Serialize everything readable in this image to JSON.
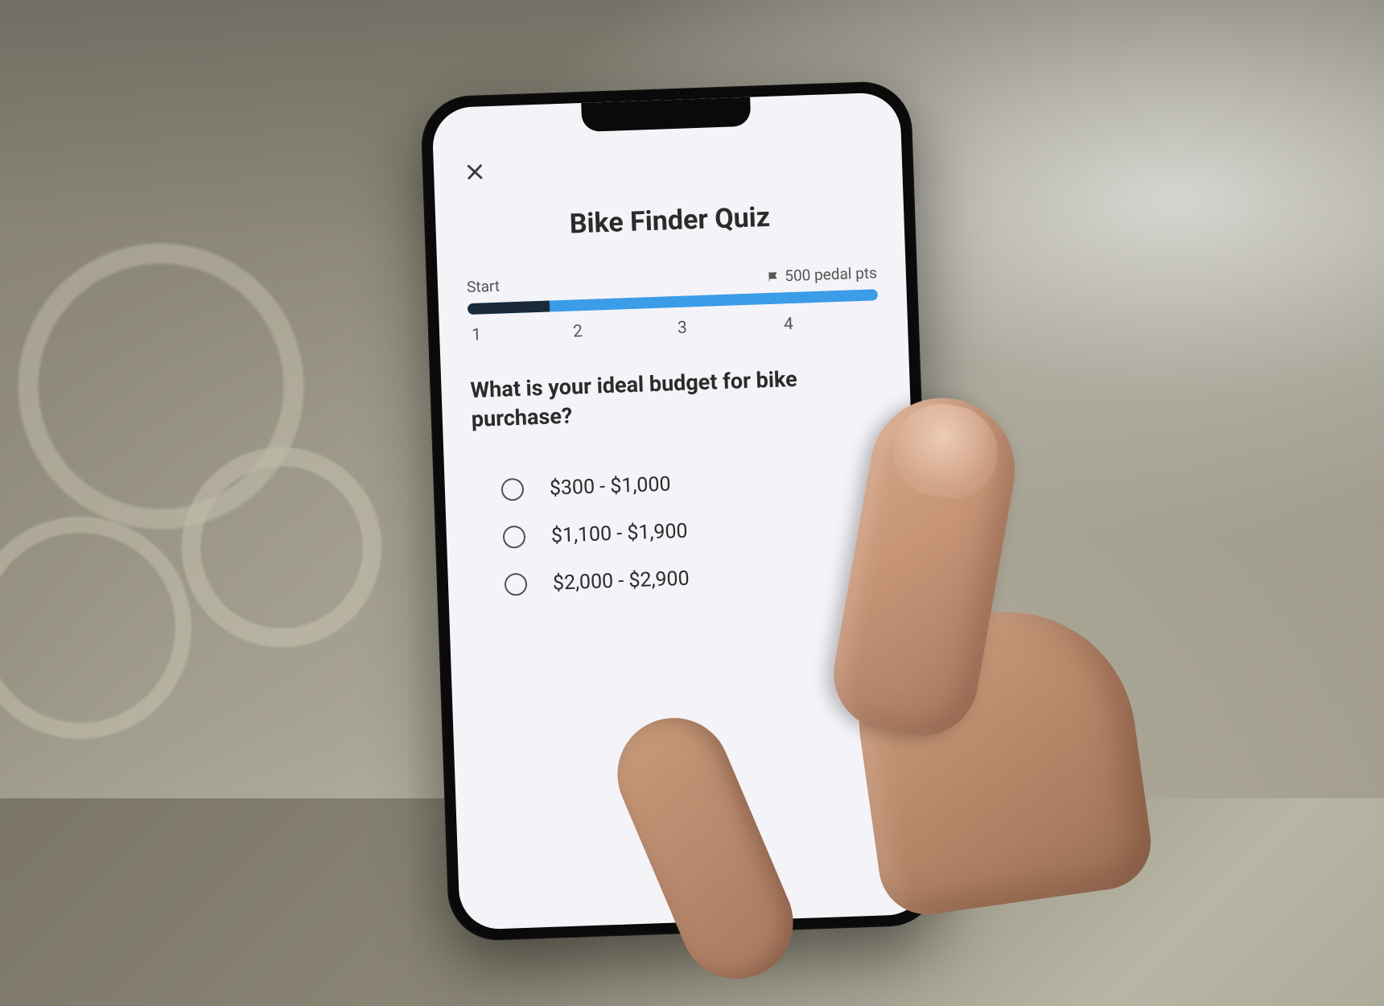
{
  "header": {
    "title": "Bike Finder Quiz"
  },
  "progress": {
    "start_label": "Start",
    "reward_label": "500 pedal pts",
    "steps": [
      "1",
      "2",
      "3",
      "4"
    ]
  },
  "question": {
    "text": "What is your ideal budget for bike purchase?"
  },
  "options": [
    {
      "label": "$300 - $1,000"
    },
    {
      "label": "$1,100 - $1,900"
    },
    {
      "label": "$2,000 - $2,900"
    }
  ]
}
